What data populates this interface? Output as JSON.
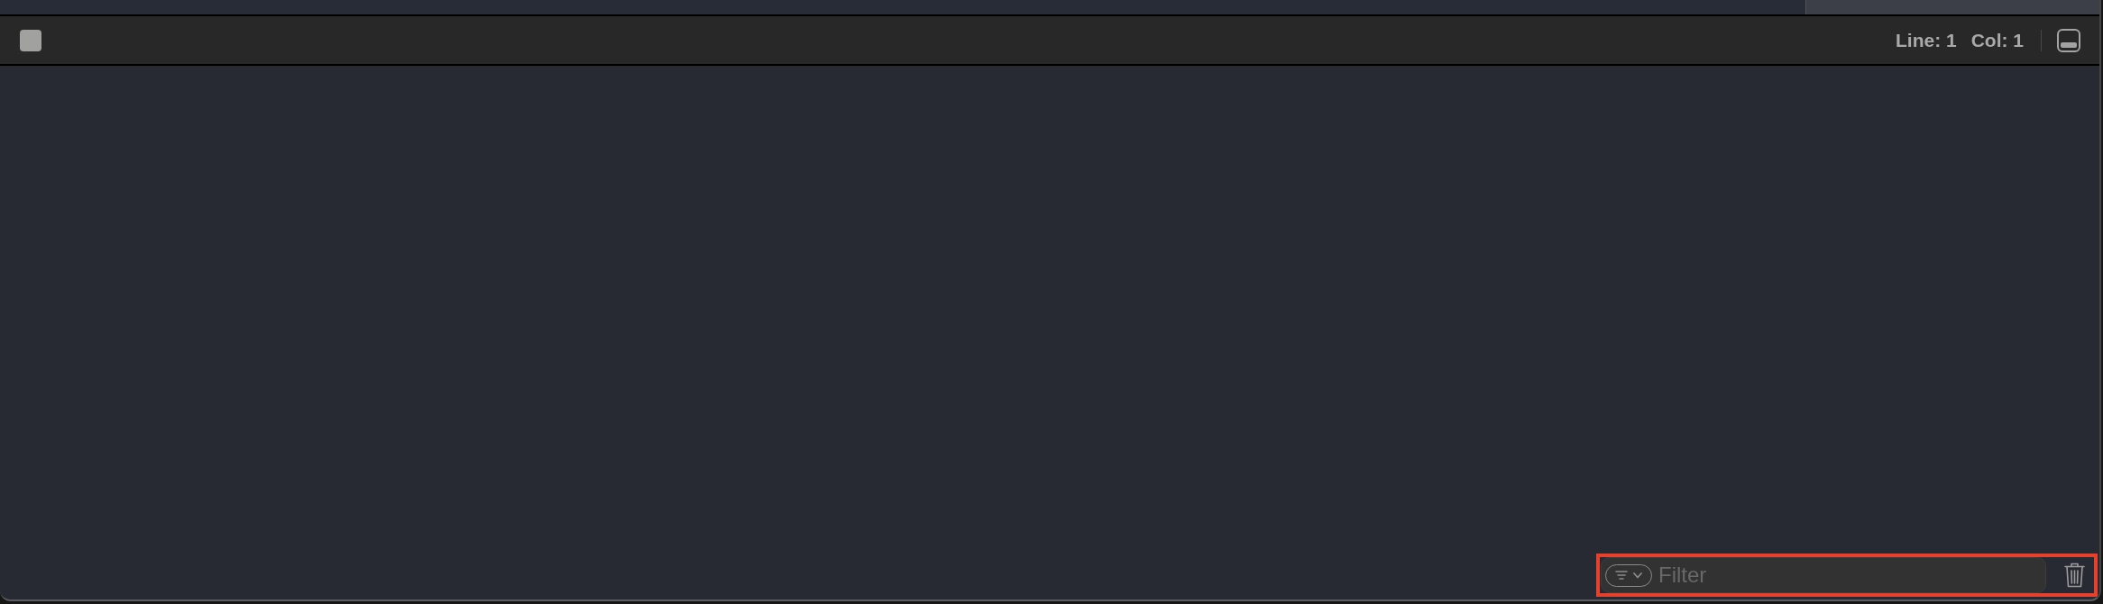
{
  "toolbar": {
    "status": [
      {
        "label": "Line: 1"
      },
      {
        "label": "Col: 1"
      }
    ]
  },
  "console": {
    "filter": {
      "placeholder": "Filter"
    }
  }
}
